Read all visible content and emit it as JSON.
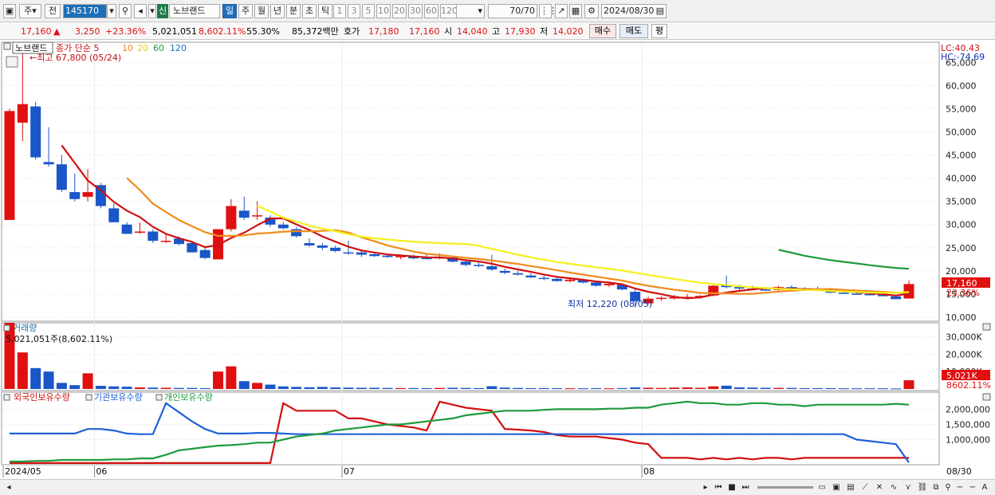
{
  "toolbar": {
    "market": "주",
    "period_prev": "전",
    "code": "145170",
    "new_label": "신",
    "stock_name": "노브랜드",
    "period_tabs": [
      "일",
      "주",
      "월",
      "년",
      "분",
      "초",
      "틱"
    ],
    "active_tab": "일",
    "intervals": [
      "1",
      "3",
      "5",
      "10",
      "20",
      "30",
      "60",
      "120"
    ],
    "count": "70",
    "count_total": "/70",
    "date": "2024/08/30"
  },
  "quote": {
    "price": "17,160",
    "change_arrow": "▲",
    "change": "3,250",
    "change_pct": "+23.36%",
    "volume": "5,021,051",
    "volume_ratio": "8,602.11%",
    "turnover": "55.30%",
    "amount": "85,372백만",
    "bid_label": "호가",
    "ask": "17,180",
    "bid": "17,160",
    "open_label": "시",
    "open": "14,040",
    "high_label": "고",
    "high": "17,930",
    "low_label": "저",
    "low": "14,020",
    "buy_label": "매수",
    "sell_label": "매도",
    "avg_label": "평"
  },
  "price_panel": {
    "stock_label": "노브랜드",
    "ma_label": "종가 단순 5",
    "ma_periods": [
      "10",
      "20",
      "60",
      "120"
    ],
    "high_note": "←최고 67,800 (05/24)",
    "low_note": "최저 12,220 (08/05)",
    "lc": "LC:40.43",
    "hc": "HC:-74.69",
    "price_tag": "17,160",
    "pct_tag": "23.36%",
    "y_ticks": [
      "65,000",
      "60,000",
      "55,000",
      "50,000",
      "45,000",
      "40,000",
      "35,000",
      "30,000",
      "25,000",
      "20,000",
      "15,000",
      "10,000"
    ]
  },
  "volume_panel": {
    "title": "거래량",
    "value": "5,021,051주(8,602.11%)",
    "y_ticks": [
      "30,000K",
      "20,000K",
      "10,000K"
    ],
    "vol_tag": "5,021K",
    "pct_tag": "8602.11%"
  },
  "holding_panel": {
    "foreign": "외국인보유수량",
    "institution": "기관보유수량",
    "individual": "개인보유수량",
    "y_ticks": [
      "2,000,000",
      "1,500,000",
      "1,000,000"
    ]
  },
  "x_axis": {
    "labels": [
      "2024/05",
      "06",
      "07",
      "08"
    ],
    "end_label": "08/30"
  },
  "colors": {
    "up": "#e01010",
    "down": "#1a56c8",
    "ma5": "#d01010",
    "ma10": "#f08c1c",
    "ma20": "#f4f01c",
    "ma60": "#1e9a3c",
    "ma120": "#1e6eb8",
    "foreign": "#d01010",
    "institution": "#2060d8",
    "individual": "#1e9a3c"
  },
  "chart_data": {
    "type": "candlestick",
    "candles": [
      {
        "o": 31000,
        "h": 55000,
        "l": 31000,
        "c": 54500
      },
      {
        "o": 52000,
        "h": 67800,
        "l": 48000,
        "c": 56000
      },
      {
        "o": 55500,
        "h": 56500,
        "l": 44000,
        "c": 44500
      },
      {
        "o": 43500,
        "h": 51000,
        "l": 42500,
        "c": 43000
      },
      {
        "o": 43000,
        "h": 45000,
        "l": 37000,
        "c": 37500
      },
      {
        "o": 37000,
        "h": 41000,
        "l": 35000,
        "c": 35500
      },
      {
        "o": 36000,
        "h": 42000,
        "l": 35000,
        "c": 37000
      },
      {
        "o": 38500,
        "h": 39000,
        "l": 33500,
        "c": 34000
      },
      {
        "o": 33500,
        "h": 34500,
        "l": 30500,
        "c": 30500
      },
      {
        "o": 30000,
        "h": 30500,
        "l": 28000,
        "c": 28000
      },
      {
        "o": 28500,
        "h": 30500,
        "l": 28000,
        "c": 28500
      },
      {
        "o": 28500,
        "h": 29000,
        "l": 26000,
        "c": 26500
      },
      {
        "o": 26500,
        "h": 28000,
        "l": 26000,
        "c": 26500
      },
      {
        "o": 27000,
        "h": 27500,
        "l": 25500,
        "c": 25800
      },
      {
        "o": 26000,
        "h": 26500,
        "l": 24000,
        "c": 24000
      },
      {
        "o": 24500,
        "h": 25000,
        "l": 22500,
        "c": 22800
      },
      {
        "o": 22500,
        "h": 29000,
        "l": 22500,
        "c": 29000
      },
      {
        "o": 29000,
        "h": 35500,
        "l": 28500,
        "c": 34000
      },
      {
        "o": 33000,
        "h": 36000,
        "l": 31000,
        "c": 31500
      },
      {
        "o": 32000,
        "h": 35000,
        "l": 31000,
        "c": 32000
      },
      {
        "o": 31500,
        "h": 32000,
        "l": 29500,
        "c": 30000
      },
      {
        "o": 30000,
        "h": 30500,
        "l": 29000,
        "c": 29200
      },
      {
        "o": 29000,
        "h": 29500,
        "l": 27200,
        "c": 27500
      },
      {
        "o": 26000,
        "h": 27000,
        "l": 25200,
        "c": 25500
      },
      {
        "o": 25500,
        "h": 26000,
        "l": 24500,
        "c": 25000
      },
      {
        "o": 25000,
        "h": 25500,
        "l": 24000,
        "c": 24300
      },
      {
        "o": 24000,
        "h": 26500,
        "l": 23500,
        "c": 23800
      },
      {
        "o": 24000,
        "h": 24500,
        "l": 23000,
        "c": 23500
      },
      {
        "o": 23600,
        "h": 24000,
        "l": 23000,
        "c": 23200
      },
      {
        "o": 23300,
        "h": 23600,
        "l": 22800,
        "c": 23000
      },
      {
        "o": 23000,
        "h": 23500,
        "l": 22500,
        "c": 23200
      },
      {
        "o": 23200,
        "h": 23500,
        "l": 22500,
        "c": 22700
      },
      {
        "o": 22800,
        "h": 23500,
        "l": 22500,
        "c": 22600
      },
      {
        "o": 22700,
        "h": 23800,
        "l": 22500,
        "c": 23000
      },
      {
        "o": 22900,
        "h": 23200,
        "l": 21800,
        "c": 22000
      },
      {
        "o": 22000,
        "h": 22500,
        "l": 21000,
        "c": 21300
      },
      {
        "o": 21300,
        "h": 21800,
        "l": 20800,
        "c": 21200
      },
      {
        "o": 21000,
        "h": 23500,
        "l": 20000,
        "c": 20300
      },
      {
        "o": 20000,
        "h": 20500,
        "l": 19300,
        "c": 19600
      },
      {
        "o": 19500,
        "h": 20000,
        "l": 19000,
        "c": 19200
      },
      {
        "o": 19000,
        "h": 19500,
        "l": 18500,
        "c": 18600
      },
      {
        "o": 18500,
        "h": 19000,
        "l": 18000,
        "c": 18400
      },
      {
        "o": 18300,
        "h": 18800,
        "l": 17700,
        "c": 17800
      },
      {
        "o": 17800,
        "h": 18300,
        "l": 17500,
        "c": 18100
      },
      {
        "o": 18000,
        "h": 18300,
        "l": 17300,
        "c": 17500
      },
      {
        "o": 17500,
        "h": 17800,
        "l": 16600,
        "c": 16800
      },
      {
        "o": 16900,
        "h": 17500,
        "l": 16500,
        "c": 17200
      },
      {
        "o": 17000,
        "h": 17200,
        "l": 15800,
        "c": 16000
      },
      {
        "o": 15500,
        "h": 16000,
        "l": 12220,
        "c": 13500
      },
      {
        "o": 13000,
        "h": 14500,
        "l": 12800,
        "c": 14000
      },
      {
        "o": 14000,
        "h": 14500,
        "l": 13500,
        "c": 14200
      },
      {
        "o": 14200,
        "h": 14800,
        "l": 13800,
        "c": 14300
      },
      {
        "o": 14300,
        "h": 15000,
        "l": 14000,
        "c": 14400
      },
      {
        "o": 14400,
        "h": 14800,
        "l": 14000,
        "c": 14600
      },
      {
        "o": 14700,
        "h": 17000,
        "l": 14500,
        "c": 16800
      },
      {
        "o": 17000,
        "h": 19000,
        "l": 16200,
        "c": 16500
      },
      {
        "o": 16500,
        "h": 17000,
        "l": 15800,
        "c": 16200
      },
      {
        "o": 16200,
        "h": 16800,
        "l": 15800,
        "c": 16000
      },
      {
        "o": 16000,
        "h": 16500,
        "l": 15700,
        "c": 15900
      },
      {
        "o": 15900,
        "h": 16800,
        "l": 15700,
        "c": 16500
      },
      {
        "o": 16500,
        "h": 16900,
        "l": 15900,
        "c": 16100
      },
      {
        "o": 16100,
        "h": 16500,
        "l": 15700,
        "c": 15900
      },
      {
        "o": 16200,
        "h": 16600,
        "l": 15600,
        "c": 15700
      },
      {
        "o": 15700,
        "h": 16000,
        "l": 15200,
        "c": 15300
      },
      {
        "o": 15300,
        "h": 15800,
        "l": 15000,
        "c": 15100
      },
      {
        "o": 15100,
        "h": 15500,
        "l": 14900,
        "c": 15000
      },
      {
        "o": 15000,
        "h": 15300,
        "l": 14700,
        "c": 14800
      },
      {
        "o": 14800,
        "h": 15200,
        "l": 14500,
        "c": 14600
      },
      {
        "o": 14500,
        "h": 14800,
        "l": 13910,
        "c": 13910
      },
      {
        "o": 14040,
        "h": 17930,
        "l": 14020,
        "c": 17160
      }
    ],
    "volume_k": [
      38000,
      21000,
      12000,
      10000,
      3500,
      2200,
      9000,
      1800,
      1500,
      1300,
      900,
      800,
      700,
      600,
      600,
      500,
      10000,
      13000,
      4500,
      3500,
      2500,
      1500,
      1200,
      1000,
      1200,
      900,
      800,
      700,
      700,
      600,
      500,
      500,
      500,
      600,
      700,
      600,
      500,
      1600,
      800,
      600,
      500,
      500,
      500,
      400,
      400,
      500,
      400,
      500,
      900,
      700,
      600,
      800,
      900,
      700,
      1500,
      1900,
      900,
      800,
      700,
      600,
      600,
      500,
      500,
      500,
      400,
      400,
      400,
      400,
      300,
      5021
    ],
    "ma_windows": [
      5,
      10,
      20,
      60
    ],
    "holding": {
      "foreign": [
        230000,
        230000,
        230000,
        230000,
        230000,
        230000,
        230000,
        230000,
        230000,
        230000,
        230000,
        230000,
        230000,
        230000,
        230000,
        230000,
        230000,
        230000,
        230000,
        230000,
        230000,
        2200000,
        1950000,
        1950000,
        1950000,
        1950000,
        1700000,
        1700000,
        1600000,
        1500000,
        1450000,
        1400000,
        1300000,
        2250000,
        2150000,
        2050000,
        2000000,
        1950000,
        1350000,
        1330000,
        1300000,
        1250000,
        1150000,
        1100000,
        1100000,
        1100000,
        1050000,
        1000000,
        900000,
        850000,
        400000,
        400000,
        400000,
        350000,
        400000,
        350000,
        400000,
        350000,
        400000,
        400000,
        350000,
        400000,
        400000,
        400000,
        400000,
        400000,
        400000,
        400000,
        400000,
        400000
      ],
      "institution": [
        1200000,
        1200000,
        1200000,
        1200000,
        1200000,
        1200000,
        1350000,
        1350000,
        1300000,
        1200000,
        1180000,
        1180000,
        2200000,
        1900000,
        1600000,
        1350000,
        1200000,
        1200000,
        1200000,
        1220000,
        1220000,
        1200000,
        1180000,
        1180000,
        1180000,
        1180000,
        1180000,
        1180000,
        1180000,
        1180000,
        1180000,
        1180000,
        1180000,
        1180000,
        1180000,
        1180000,
        1180000,
        1180000,
        1180000,
        1180000,
        1180000,
        1180000,
        1180000,
        1180000,
        1180000,
        1180000,
        1180000,
        1180000,
        1180000,
        1180000,
        1180000,
        1180000,
        1180000,
        1180000,
        1180000,
        1180000,
        1180000,
        1180000,
        1180000,
        1180000,
        1180000,
        1180000,
        1180000,
        1180000,
        1180000,
        1000000,
        950000,
        900000,
        850000,
        250000
      ],
      "individual": [
        280000,
        280000,
        300000,
        300000,
        330000,
        330000,
        330000,
        330000,
        350000,
        350000,
        380000,
        380000,
        500000,
        650000,
        700000,
        750000,
        800000,
        820000,
        850000,
        900000,
        900000,
        1000000,
        1100000,
        1150000,
        1200000,
        1300000,
        1350000,
        1400000,
        1450000,
        1500000,
        1500000,
        1550000,
        1600000,
        1650000,
        1700000,
        1800000,
        1850000,
        1900000,
        1950000,
        1950000,
        1950000,
        1980000,
        2000000,
        2000000,
        2000000,
        2000000,
        2020000,
        2020000,
        2050000,
        2050000,
        2150000,
        2200000,
        2250000,
        2200000,
        2200000,
        2150000,
        2150000,
        2200000,
        2200000,
        2150000,
        2150000,
        2100000,
        2150000,
        2150000,
        2150000,
        2150000,
        2150000,
        2150000,
        2180000,
        2150000
      ]
    },
    "x_labels": [
      "2024/05",
      "06",
      "07",
      "08"
    ],
    "price_ylim": [
      10000,
      67800
    ],
    "volume_ylim": [
      0,
      38000
    ],
    "holding_ylim": [
      200000,
      2300000
    ]
  }
}
